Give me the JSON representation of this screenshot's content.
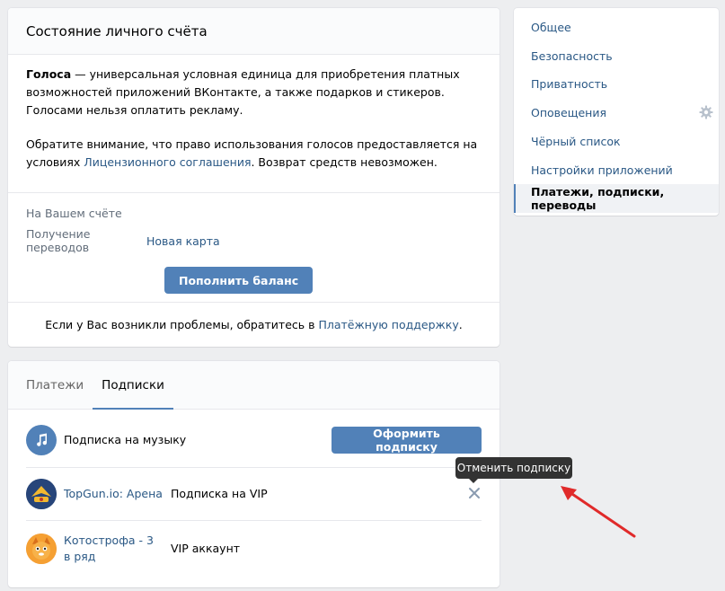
{
  "account": {
    "title": "Состояние личного счёта",
    "intro_bold": "Голоса",
    "intro_text": " — универсальная условная единица для приобретения платных возможностей приложений ВКонтакте, а также подарков и стикеров. Голосами нельзя оплатить рекламу.",
    "notice_text": "Обратите внимание, что право использования голосов предоставляется на условиях ",
    "notice_link": "Лицензионного соглашения",
    "notice_tail": ". Возврат средств невозможен.",
    "balance_label": "На Вашем счёте",
    "transfers_label": "Получение переводов",
    "new_card_link": "Новая карта",
    "topup_button": "Пополнить баланс",
    "support_text": "Если у Вас возникли проблемы, обратитесь в ",
    "support_link": "Платёжную поддержку",
    "support_tail": "."
  },
  "subs": {
    "tabs": [
      {
        "label": "Платежи",
        "active": false
      },
      {
        "label": "Подписки",
        "active": true
      }
    ],
    "music": {
      "name": "Подписка на музыку",
      "button": "Оформить подписку"
    },
    "items": [
      {
        "app": "TopGun.io: Арена",
        "type": "Подписка на VIP",
        "icon": "topgun-app-icon"
      },
      {
        "app": "Котострофа - 3 в ряд",
        "type": "VIP аккаунт",
        "icon": "cat-app-icon"
      }
    ]
  },
  "menu": {
    "items": [
      {
        "label": "Общее",
        "active": false
      },
      {
        "label": "Безопасность",
        "active": false
      },
      {
        "label": "Приватность",
        "active": false
      },
      {
        "label": "Оповещения",
        "active": false
      },
      {
        "label": "Чёрный список",
        "active": false
      },
      {
        "label": "Настройки приложений",
        "active": false
      },
      {
        "label": "Платежи, подписки, переводы",
        "active": true
      }
    ]
  },
  "tooltip": {
    "text": "Отменить подписку"
  },
  "colors": {
    "accent": "#5181b8",
    "link": "#2a5885",
    "background": "#edeef0",
    "annotation_arrow": "#e02a2a"
  }
}
